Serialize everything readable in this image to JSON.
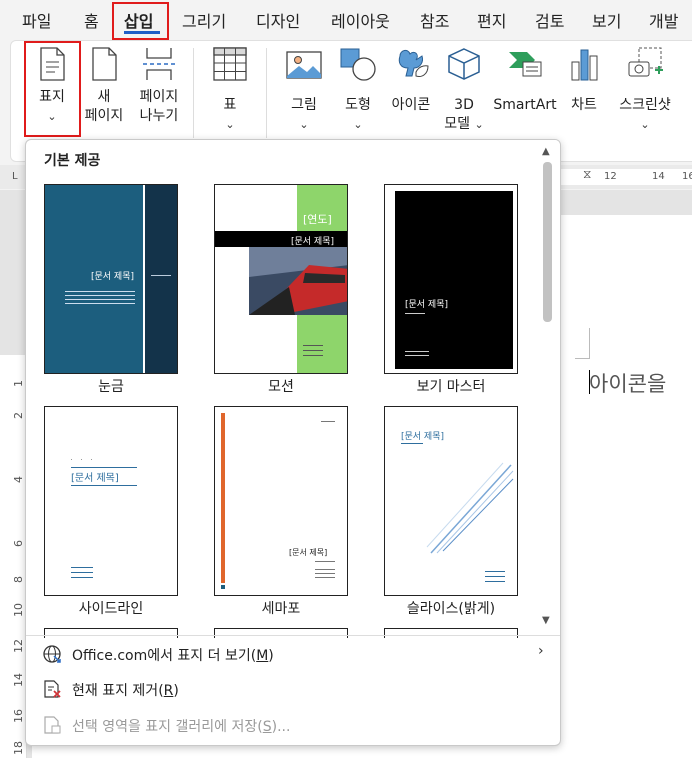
{
  "tabs": [
    "파일",
    "홈",
    "삽입",
    "그리기",
    "디자인",
    "레이아웃",
    "참조",
    "편지",
    "검토",
    "보기",
    "개발"
  ],
  "active_tab": "삽입",
  "ribbon": {
    "cover": "표지",
    "blank_page": [
      "새",
      "페이지"
    ],
    "page_break": [
      "페이지",
      "나누기"
    ],
    "table": "표",
    "pictures": "그림",
    "shapes": "도형",
    "icons": "아이콘",
    "model_3d": [
      "3D",
      "모델"
    ],
    "smartart": "SmartArt",
    "chart": "차트",
    "screenshot": "스크린샷"
  },
  "document": {
    "text": "아이콘을"
  },
  "ruler_numbers": [
    "1",
    "2",
    "4",
    "6",
    "8",
    "10",
    "12",
    "14",
    "16",
    "18"
  ],
  "top_ruler_numbers": [
    "12",
    "14",
    "16"
  ],
  "dropdown": {
    "section_title": "기본 제공",
    "thumbnails": [
      {
        "name": "눈금",
        "doc_title": "[문서 제목]",
        "colors": [
          "#1c5e7e",
          "#13334a"
        ]
      },
      {
        "name": "모션",
        "doc_title": "[문서 제목]",
        "year": "[연도]",
        "colors": [
          "#8ed56b",
          "#000000"
        ]
      },
      {
        "name": "보기 마스터",
        "doc_title": "[문서 제목]",
        "colors": [
          "#000000"
        ]
      },
      {
        "name": "사이드라인",
        "doc_title": "[문서 제목]",
        "colors": [
          "#2e6e9e"
        ]
      },
      {
        "name": "세마포",
        "doc_title": "[문서 제목]",
        "colors": [
          "#e0662c"
        ]
      },
      {
        "name": "슬라이스(밝게)",
        "doc_title": "[문서 제목]",
        "colors": [
          "#2e6e9e"
        ]
      }
    ],
    "menu_items": [
      {
        "text": "Office.com에서 표지 더 보기",
        "key": "M",
        "icon": "globe-icon"
      },
      {
        "text": "현재 표지 제거",
        "key": "R",
        "icon": "remove-cover-icon"
      },
      {
        "text": "선택 영역을 표지 갤러리에 저장",
        "key": "S",
        "suffix": "...",
        "icon": "save-cover-icon"
      }
    ]
  }
}
